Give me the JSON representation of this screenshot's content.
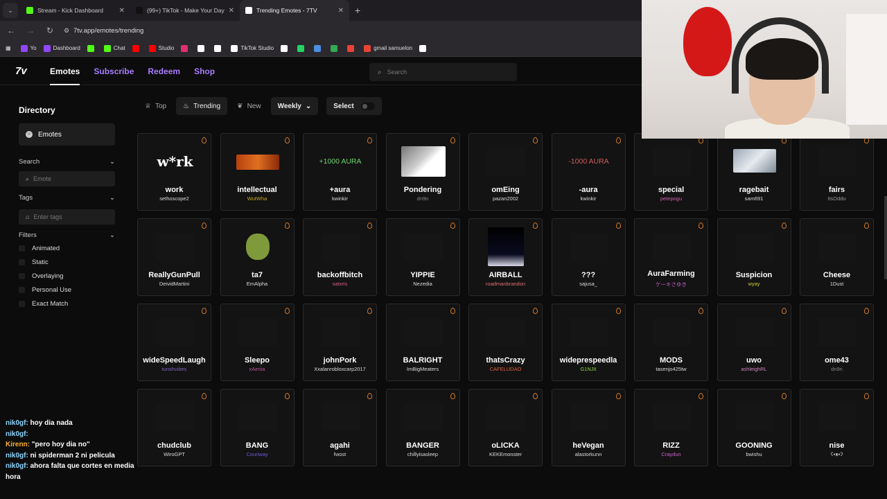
{
  "browser": {
    "tabs": [
      {
        "title": "Stream - Kick Dashboard",
        "color": "#53fc18",
        "active": false
      },
      {
        "title": "(99+) TikTok - Make Your Day",
        "color": "#111111",
        "active": false
      },
      {
        "title": "Trending Emotes - 7TV",
        "color": "#ffffff",
        "active": true
      }
    ],
    "url": "7tv.app/emotes/trending",
    "bookmarks": [
      {
        "label": "Yo",
        "color": "#9146ff"
      },
      {
        "label": "Dashboard",
        "color": "#9146ff"
      },
      {
        "label": "",
        "color": "#53fc18"
      },
      {
        "label": "Chat",
        "color": "#53fc18"
      },
      {
        "label": "",
        "color": "#ff0000"
      },
      {
        "label": "Studio",
        "color": "#ff0000"
      },
      {
        "label": "",
        "color": "#e1306c"
      },
      {
        "label": "",
        "color": "#ffffff"
      },
      {
        "label": "",
        "color": "#ffffff"
      },
      {
        "label": "TikTok Studio",
        "color": "#ffffff"
      },
      {
        "label": "",
        "color": "#ffffff"
      },
      {
        "label": "",
        "color": "#25d366"
      },
      {
        "label": "",
        "color": "#4a90e2"
      },
      {
        "label": "",
        "color": "#34a853"
      },
      {
        "label": "",
        "color": "#ea4335"
      },
      {
        "label": "gmail samuelon",
        "color": "#ea4335"
      },
      {
        "label": "",
        "color": "#ffffff"
      }
    ]
  },
  "site": {
    "logo": "7v",
    "nav": [
      "Emotes",
      "Subscribe",
      "Redeem",
      "Shop"
    ],
    "search_placeholder": "Search"
  },
  "sidebar": {
    "title": "Directory",
    "emotes_label": "Emotes",
    "search_label": "Search",
    "emote_placeholder": "Emote",
    "tags_label": "Tags",
    "tags_placeholder": "Enter tags",
    "filters_label": "Filters",
    "filters": [
      "Animated",
      "Static",
      "Overlaying",
      "Personal Use",
      "Exact Match"
    ]
  },
  "toolbar": {
    "top": "Top",
    "trending": "Trending",
    "new": "New",
    "weekly": "Weekly",
    "select": "Select"
  },
  "emotes": [
    {
      "name": "work",
      "by": "sethoscope2",
      "byColor": "#dddddd",
      "img": "w*rk",
      "type": "text"
    },
    {
      "name": "intellectual",
      "by": "WutWha",
      "byColor": "#c9a227",
      "img": "",
      "type": "fire"
    },
    {
      "name": "+aura",
      "by": "kwinkir",
      "byColor": "#dddddd",
      "img": "+1000 AURA",
      "type": "aura",
      "color": "#6dd46d"
    },
    {
      "name": "Pondering",
      "by": "dn9n",
      "byColor": "#888888",
      "img": "",
      "type": "cat"
    },
    {
      "name": "omEing",
      "by": "pazan2002",
      "byColor": "#dddddd",
      "img": "",
      "type": "dark"
    },
    {
      "name": "-aura",
      "by": "kwinkir",
      "byColor": "#dddddd",
      "img": "-1000 AURA",
      "type": "aura",
      "color": "#d05a5a"
    },
    {
      "name": "special",
      "by": "petepogu",
      "byColor": "#d060a8",
      "img": "",
      "type": "dark"
    },
    {
      "name": "ragebait",
      "by": "sam691",
      "byColor": "#dddddd",
      "img": "",
      "type": "wolf"
    },
    {
      "name": "fairs",
      "by": "ItsOddo",
      "byColor": "#999999",
      "img": "",
      "type": "dark"
    },
    {
      "name": "ReallyGunPull",
      "by": "DeividMartini",
      "byColor": "#dddddd",
      "img": "",
      "type": "dark"
    },
    {
      "name": "ta7",
      "by": "EmAlpha",
      "byColor": "#dddddd",
      "img": "",
      "type": "pepe"
    },
    {
      "name": "backoffbitch",
      "by": "satxris",
      "byColor": "#e05a8a",
      "img": "",
      "type": "dark"
    },
    {
      "name": "YIPPIE",
      "by": "Nezedia",
      "byColor": "#dddddd",
      "img": "",
      "type": "dark"
    },
    {
      "name": "AIRBALL",
      "by": "roadmanbrandon",
      "byColor": "#e07070",
      "img": "",
      "type": "ball"
    },
    {
      "name": "???",
      "by": "sajusa_",
      "byColor": "#dddddd",
      "img": "",
      "type": "dark"
    },
    {
      "name": "AuraFarming",
      "by": "ケーキさゆき",
      "byColor": "#c060c0",
      "img": "",
      "type": "dark"
    },
    {
      "name": "Suspicion",
      "by": "wyay",
      "byColor": "#c9c93a",
      "img": "",
      "type": "dark"
    },
    {
      "name": "Cheese",
      "by": "1Dust",
      "byColor": "#dddddd",
      "img": "",
      "type": "dark"
    },
    {
      "name": "wideSpeedLaugh",
      "by": "tunshvibes",
      "byColor": "#8060c0",
      "img": "",
      "type": "dark"
    },
    {
      "name": "Sleepo",
      "by": "xAeriia",
      "byColor": "#c050a0",
      "img": "",
      "type": "dark"
    },
    {
      "name": "johnPork",
      "by": "Xxalanrobloxcarp2017",
      "byColor": "#dddddd",
      "img": "",
      "type": "dark"
    },
    {
      "name": "BALRIGHT",
      "by": "ImBigMeaters",
      "byColor": "#dddddd",
      "img": "",
      "type": "dark"
    },
    {
      "name": "thatsCrazy",
      "by": "CAFELUDAO",
      "byColor": "#e06040",
      "img": "",
      "type": "dark"
    },
    {
      "name": "wideprespeedla",
      "by": "G1NJII",
      "byColor": "#8ad64a",
      "img": "",
      "type": "dark"
    },
    {
      "name": "MODS",
      "by": "tasenjo425tw",
      "byColor": "#dddddd",
      "img": "",
      "type": "dark"
    },
    {
      "name": "uwo",
      "by": "ashleighRL",
      "byColor": "#d080c0",
      "img": "",
      "type": "dark"
    },
    {
      "name": "ome43",
      "by": "dn9n",
      "byColor": "#888888",
      "img": "",
      "type": "dark"
    },
    {
      "name": "chudclub",
      "by": "WiroGPT",
      "byColor": "#dddddd",
      "img": "",
      "type": "dark"
    },
    {
      "name": "BANG",
      "by": "Couriway",
      "byColor": "#6b5bd6",
      "img": "",
      "type": "dark"
    },
    {
      "name": "agahi",
      "by": "fwost",
      "byColor": "#dddddd",
      "img": "",
      "type": "dark"
    },
    {
      "name": "BANGER",
      "by": "chillyisasleep",
      "byColor": "#dddddd",
      "img": "",
      "type": "dark"
    },
    {
      "name": "oLICKA",
      "by": "KEKEmonster",
      "byColor": "#dddddd",
      "img": "",
      "type": "dark"
    },
    {
      "name": "heVegan",
      "by": "alastorkunn",
      "byColor": "#dddddd",
      "img": "",
      "type": "dark"
    },
    {
      "name": "RIZZ",
      "by": "Craydun",
      "byColor": "#d060d0",
      "img": "",
      "type": "dark"
    },
    {
      "name": "GOONING",
      "by": "bwishu",
      "byColor": "#dddddd",
      "img": "",
      "type": "dark"
    },
    {
      "name": "nise",
      "by": "ʕ•ᴥ•ʔ",
      "byColor": "#dddddd",
      "img": "",
      "type": "dark"
    }
  ],
  "chat": [
    {
      "user": "nik0gf:",
      "msg": "hoy dia nada",
      "userColor": "#8fd6ff"
    },
    {
      "user": "nik0gf:",
      "msg": "",
      "userColor": "#8fd6ff"
    },
    {
      "user": "Kirenn:",
      "msg": "\"pero hoy dia no\"",
      "userColor": "#ffb02e"
    },
    {
      "user": "nik0gf:",
      "msg": "ni spiderman 2 ni pelicula",
      "userColor": "#8fd6ff"
    },
    {
      "user": "nik0gf:",
      "msg": "ahora falta que cortes en media hora",
      "userColor": "#8fd6ff"
    }
  ]
}
